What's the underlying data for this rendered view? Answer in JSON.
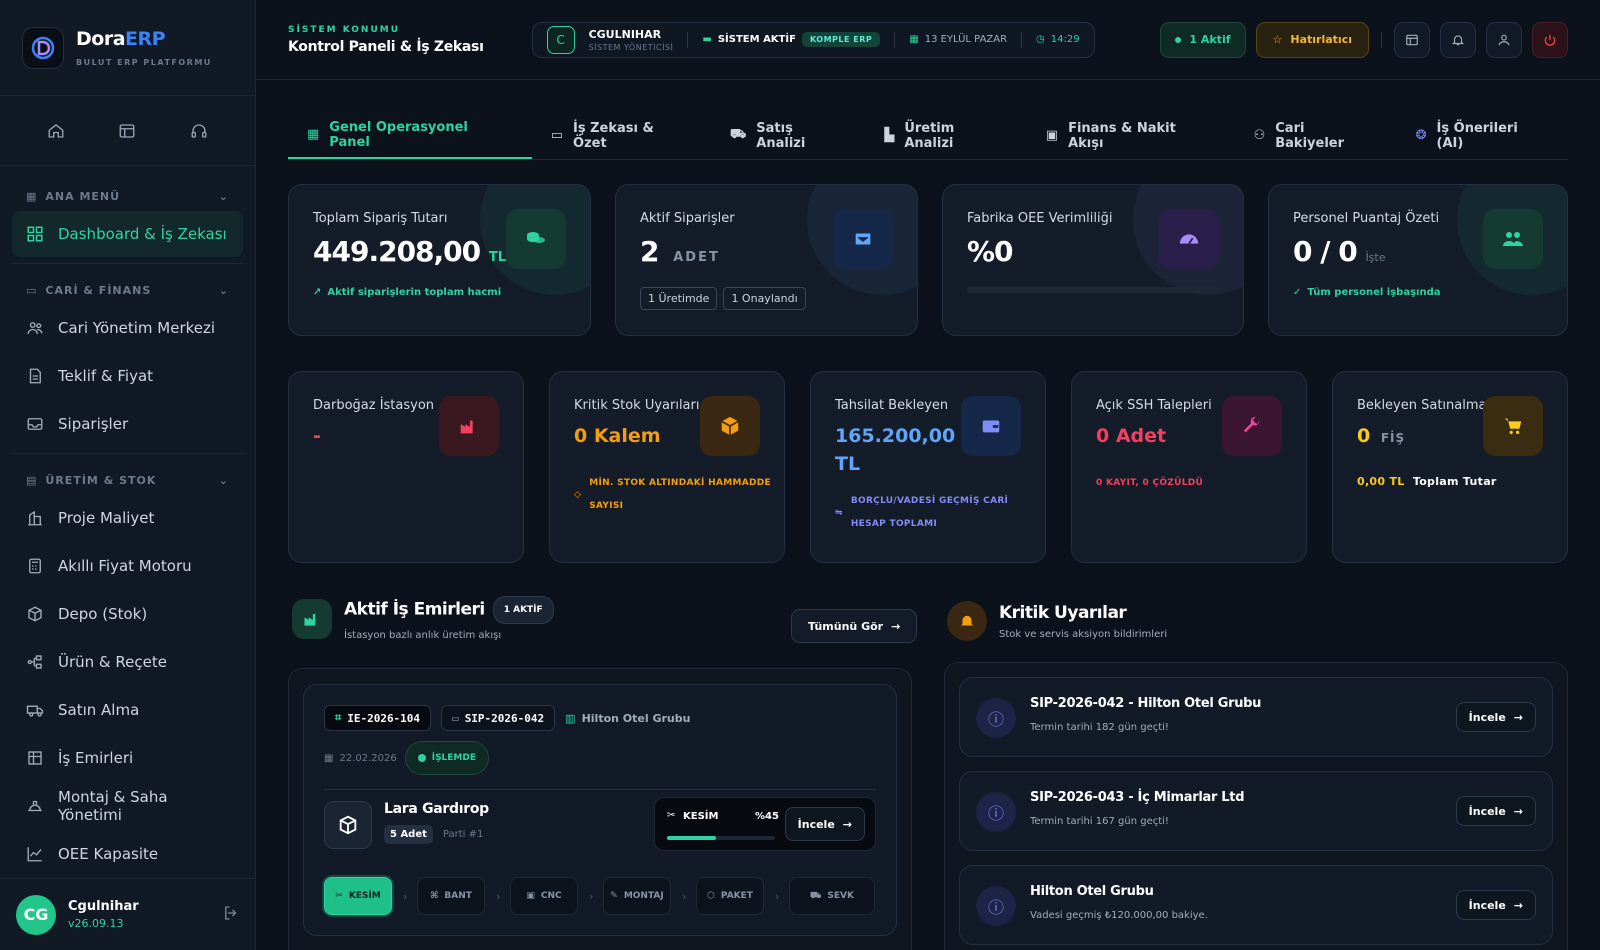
{
  "brand": {
    "name_main": "Dora",
    "name_accent": "ERP",
    "subtitle": "BULUT ERP PLATFORMU"
  },
  "sidebar": {
    "sections": [
      {
        "title": "ANA MENÜ",
        "items": [
          {
            "label": "Dashboard & İş Zekası"
          }
        ]
      },
      {
        "title": "CARİ & FİNANS",
        "items": [
          {
            "label": "Cari Yönetim Merkezi"
          },
          {
            "label": "Teklif & Fiyat"
          },
          {
            "label": "Siparişler"
          }
        ]
      },
      {
        "title": "ÜRETİM & STOK",
        "items": [
          {
            "label": "Proje Maliyet"
          },
          {
            "label": "Akıllı Fiyat Motoru"
          },
          {
            "label": "Depo (Stok)"
          },
          {
            "label": "Ürün & Reçete"
          },
          {
            "label": "Satın Alma"
          },
          {
            "label": "İş Emirleri"
          },
          {
            "label": "Montaj & Saha Yönetimi"
          },
          {
            "label": "OEE Kapasite"
          }
        ]
      }
    ],
    "user": {
      "initials": "CG",
      "name": "Cgulnihar",
      "version": "v26.09.13"
    }
  },
  "topbar": {
    "system_label": "SİSTEM KONUMU",
    "system_title": "Kontrol Paneli & İş Zekası",
    "user_initial": "C",
    "user_name": "CGULNIHAR",
    "user_role": "SİSTEM YÖNETİCİSİ",
    "status": "SİSTEM AKTİF",
    "erp_badge": "KOMPLE ERP",
    "date": "13 EYLÜL PAZAR",
    "time": "14:29",
    "active_btn": "1 Aktif",
    "reminder_btn": "Hatırlatıcı"
  },
  "tabs": [
    {
      "label": "Genel Operasyonel Panel",
      "icon": "grid-icon"
    },
    {
      "label": "İş Zekası & Özet",
      "icon": "presentation-icon"
    },
    {
      "label": "Satış Analizi",
      "icon": "cart-icon"
    },
    {
      "label": "Üretim Analizi",
      "icon": "factory-icon"
    },
    {
      "label": "Finans & Nakit Akışı",
      "icon": "cash-icon"
    },
    {
      "label": "Cari Bakiyeler",
      "icon": "users-icon"
    },
    {
      "label": "İş Önerileri (AI)",
      "icon": "brain-icon"
    }
  ],
  "kpis": {
    "orders_total": {
      "title": "Toplam Sipariş Tutarı",
      "value": "449.208,00",
      "unit": "TL",
      "foot": "Aktif siparişlerin toplam hacmi"
    },
    "active_orders": {
      "title": "Aktif Siparişler",
      "value": "2",
      "unit": "ADET",
      "tags": [
        "1 Üretimde",
        "1 Onaylandı"
      ]
    },
    "oee": {
      "title": "Fabrika OEE Verimliliği",
      "value": "%0",
      "progress": 0
    },
    "attendance": {
      "title": "Personel Puantaj Özeti",
      "value": "0 / 0",
      "unit": "İşte",
      "foot": "Tüm personel işbaşında"
    },
    "bottleneck": {
      "title": "Darboğaz İstasyon",
      "value": "-"
    },
    "critical_stock": {
      "title": "Kritik Stok Uyarıları",
      "value": "0 Kalem",
      "foot": "MİN. STOK ALTINDAKİ HAMMADDE SAYISI"
    },
    "collection": {
      "title": "Tahsilat Bekleyen",
      "value": "165.200,00 TL",
      "foot": "BORÇLU/VADESİ GEÇMİŞ CARİ HESAP TOPLAMI"
    },
    "ssh": {
      "title": "Açık SSH Talepleri",
      "value": "0 Adet",
      "foot": "0 KAYIT, 0 ÇÖZÜLDÜ"
    },
    "purchase": {
      "title": "Bekleyen Satınalma",
      "value": "0",
      "unit": "FİŞ",
      "foot_value": "0,00 TL",
      "foot_label": "Toplam Tutar"
    }
  },
  "work_orders": {
    "title": "Aktif İş Emirleri",
    "badge": "1 AKTİF",
    "subtitle": "İstasyon bazlı anlık üretim akışı",
    "view_all": "Tümünü Gör",
    "job": {
      "code": "IE-2026-104",
      "order": "SIP-2026-042",
      "customer": "Hilton Otel Grubu",
      "date": "22.02.2026",
      "status": "İŞLEMDE",
      "product": "Lara Gardırop",
      "qty": "5 Adet",
      "part": "Parti #1",
      "stage": "KESİM",
      "progress_label": "%45",
      "progress": 0.45,
      "inspect": "İncele",
      "stages": [
        {
          "label": "KESİM",
          "icon": "scissors-icon"
        },
        {
          "label": "BANT",
          "icon": "tape-icon"
        },
        {
          "label": "CNC",
          "icon": "cpu-icon"
        },
        {
          "label": "MONTAJ",
          "icon": "wrench-icon"
        },
        {
          "label": "PAKET",
          "icon": "package-icon"
        },
        {
          "label": "SEVK",
          "icon": "truck-icon"
        }
      ]
    }
  },
  "alerts": {
    "title": "Kritik Uyarılar",
    "subtitle": "Stok ve servis aksiyon bildirimleri",
    "items": [
      {
        "title": "SIP-2026-042 - Hilton Otel Grubu",
        "subtitle": "Termin tarihi 182 gün geçti!",
        "action": "İncele"
      },
      {
        "title": "SIP-2026-043 - İç Mimarlar Ltd",
        "subtitle": "Termin tarihi 167 gün geçti!",
        "action": "İncele"
      },
      {
        "title": "Hilton Otel Grubu",
        "subtitle": "Vadesi geçmiş ₺120.000,00 bakiye.",
        "action": "İncele"
      }
    ]
  },
  "colors": {
    "accent": "#2dd4a0",
    "orange": "#f59e0b",
    "red": "#ef4444",
    "blue": "#60a5fa",
    "pink": "#f43f5e",
    "yellow": "#facc15"
  }
}
